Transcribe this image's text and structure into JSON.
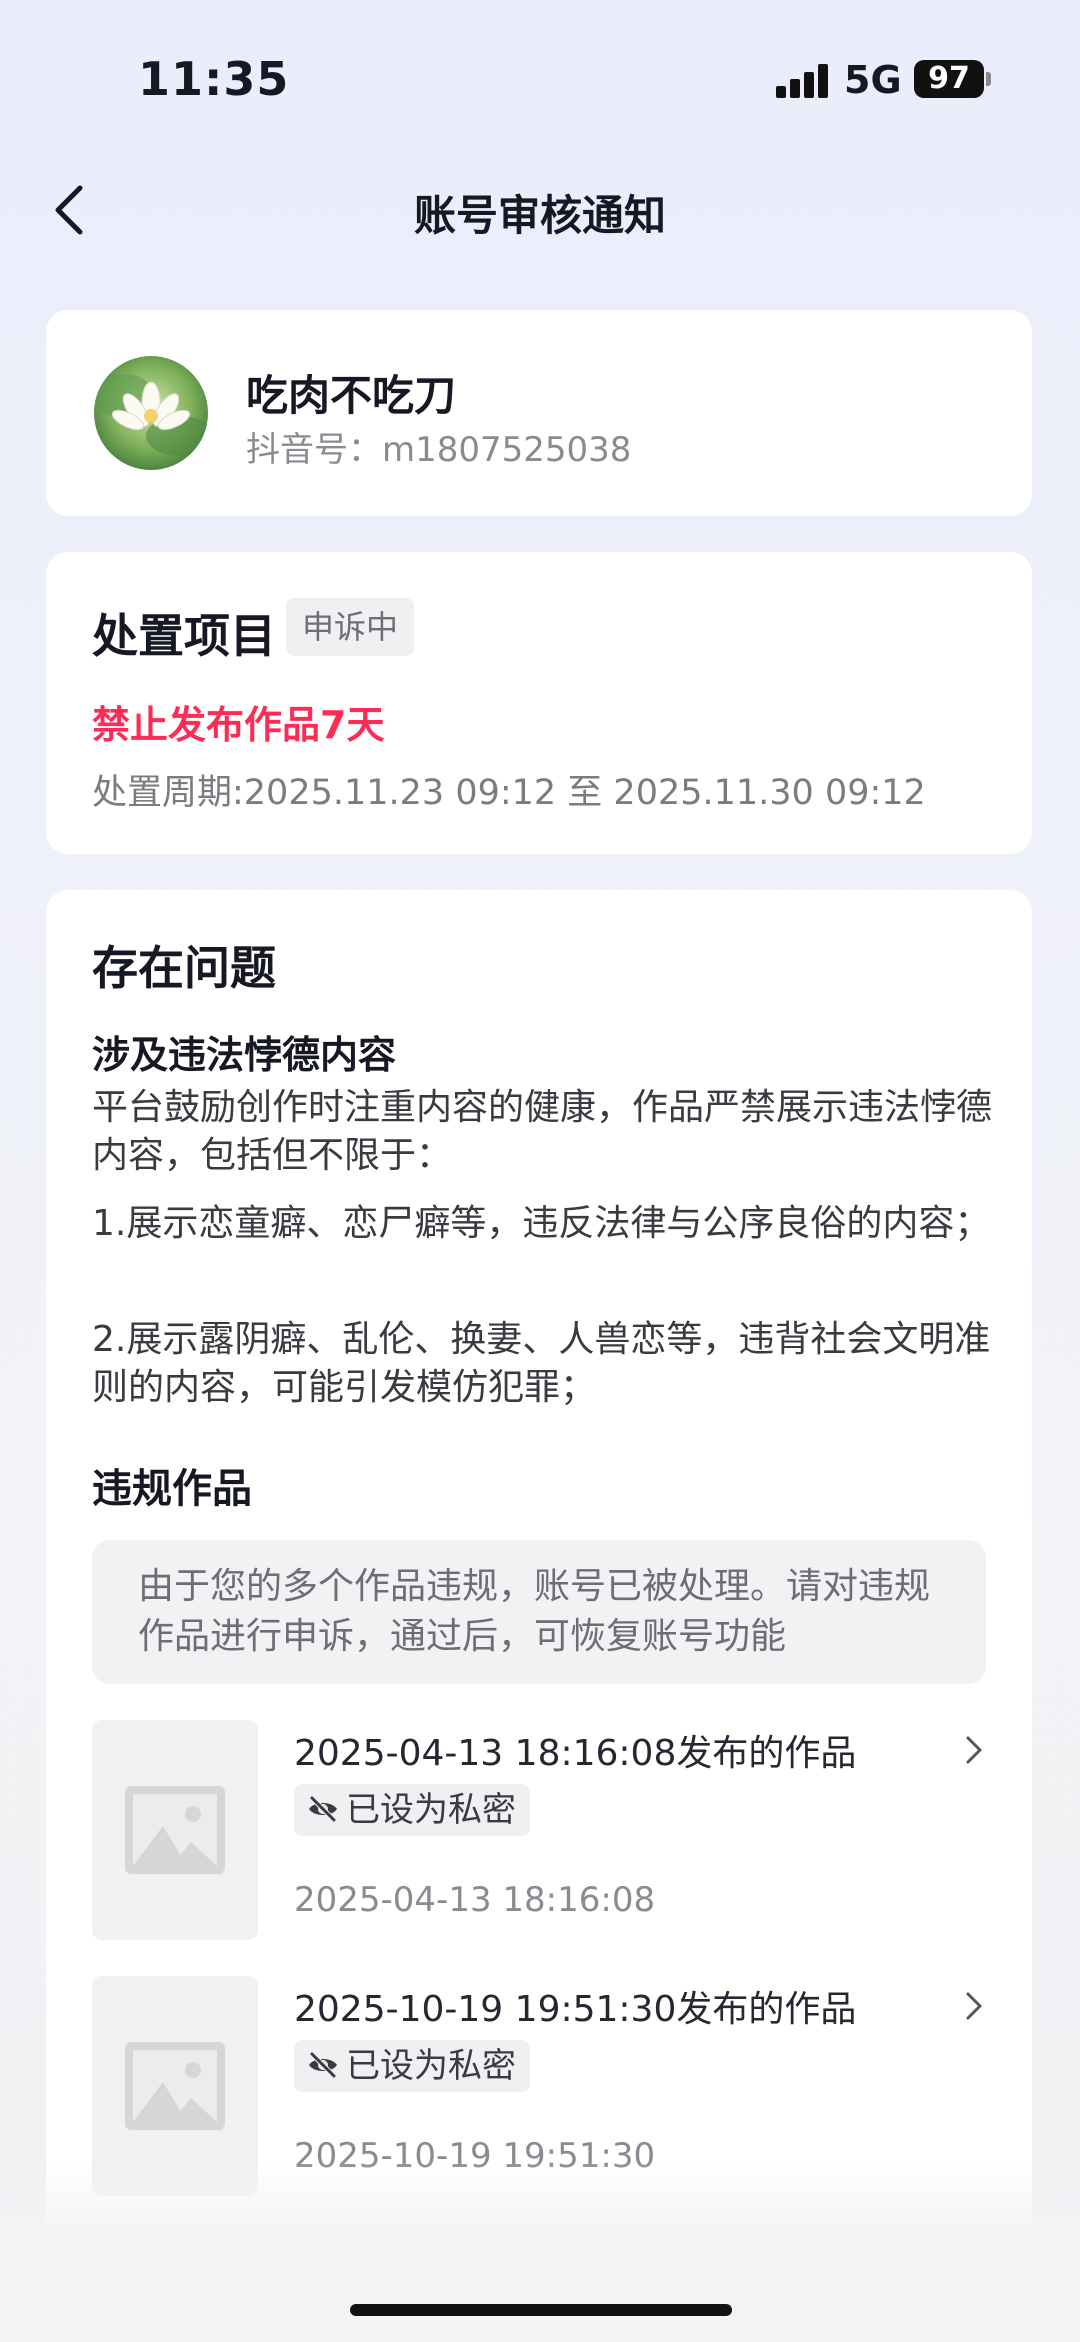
{
  "status": {
    "time": "11:35",
    "network": "5G",
    "battery": "97"
  },
  "nav": {
    "title": "账号审核通知"
  },
  "profile": {
    "name": "吃肉不吃刀",
    "id_label": "抖音号：m1807525038"
  },
  "action": {
    "title": "处置项目",
    "badge": "申诉中",
    "ban": "禁止发布作品7天",
    "period": "处置周期:2025.11.23 09:12 至 2025.11.30 09:12"
  },
  "issue": {
    "title": "存在问题",
    "subtitle": "涉及违法悖德内容",
    "paragraphs": [
      "平台鼓励创作时注重内容的健康，作品严禁展示违法悖德内容，包括但不限于：",
      "1.展示恋童癖、恋尸癖等，违反法律与公序良俗的内容；",
      "2.展示露阴癖、乱伦、换妻、人兽恋等，违背社会文明准则的内容，可能引发模仿犯罪；"
    ],
    "works_title": "违规作品",
    "notice": "由于您的多个作品违规，账号已被处理。请对违规作品进行申诉，通过后，可恢复账号功能",
    "works": [
      {
        "title": "2025-04-13 18:16:08发布的作品",
        "private_label": "已设为私密",
        "date": "2025-04-13 18:16:08"
      },
      {
        "title": "2025-10-19 19:51:30发布的作品",
        "private_label": "已设为私密",
        "date": "2025-10-19 19:51:30"
      }
    ]
  },
  "colors": {
    "accent_red": "#fe2c55",
    "background": "#eef0f9"
  },
  "icons": [
    "back-arrow-icon",
    "signal-icon",
    "battery-icon",
    "lotus-avatar",
    "eye-off-icon",
    "image-placeholder-icon",
    "chevron-right-icon"
  ]
}
